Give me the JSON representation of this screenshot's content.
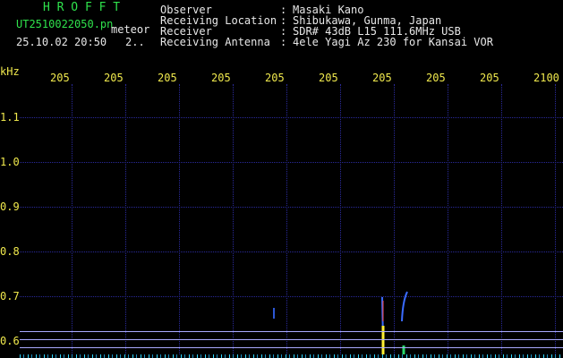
{
  "header": {
    "app_title": "H R O F F T",
    "filename": "UT2510022050.pn",
    "tag": "meteor",
    "datetime": "25.10.02 20:50",
    "counter": "2..",
    "fields": [
      {
        "label": "Observer",
        "value": "Masaki Kano"
      },
      {
        "label": "Receiving Location",
        "value": "Shibukawa, Gunma, Japan"
      },
      {
        "label": "Receiver",
        "value": "SDR# 43dB L15 111.6MHz USB"
      },
      {
        "label": "Receiving Antenna",
        "value": "4ele Yagi Az 230 for Kansai VOR"
      }
    ]
  },
  "plot": {
    "y_unit": "kHz",
    "x_ticks": [
      "205",
      "205",
      "205",
      "205",
      "205",
      "205",
      "205",
      "205",
      "205",
      "2100"
    ],
    "y_ticks": [
      "1.1",
      "1.0",
      "0.9",
      "0.8",
      "0.7",
      "0.6"
    ]
  },
  "colors": {
    "title_green": "#2fe24c",
    "tick_yellow": "#f0e94d",
    "grid_blue": "#2a2a9a",
    "signal_line": "#a9a9ff",
    "noise_cyan": "#2fd6ff"
  }
}
